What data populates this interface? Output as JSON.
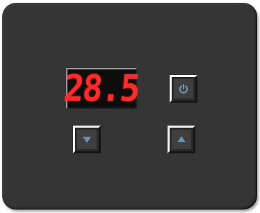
{
  "thermostat": {
    "temperature_display": "28.5",
    "display_color": "#ff2a2a",
    "panel_color": "#353535",
    "icons": {
      "power": "power-icon",
      "decrease": "triangle-down-icon",
      "increase": "triangle-up-icon"
    }
  }
}
